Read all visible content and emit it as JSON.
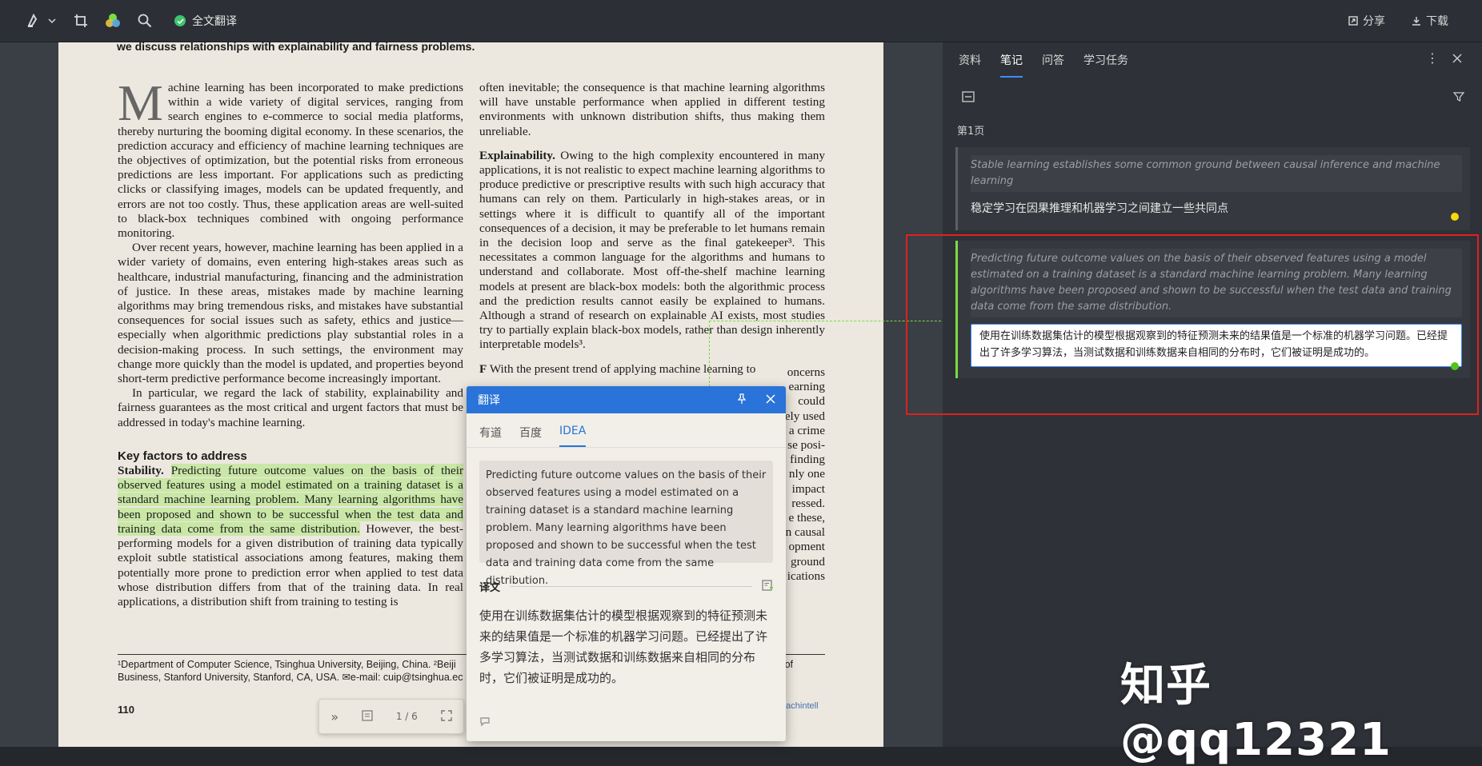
{
  "toolbar": {
    "translate_all_label": "全文翻译",
    "share_label": "分享",
    "download_label": "下载"
  },
  "document": {
    "top_heading": "we discuss relationships with explainability and fairness problems.",
    "col1": {
      "dropcap": "M",
      "p1": "achine learning has been incorporated to make predictions within a wide variety of digital services, ranging from search engines to e-commerce to social media platforms, thereby nurturing the booming digital economy. In these scenarios, the prediction accuracy and efficiency of machine learning techniques are the objectives of optimization, but the potential risks from erroneous predictions are less important. For applications such as predicting clicks or classifying images, models can be updated frequently, and errors are not too costly. Thus, these application areas are well-suited to black-box techniques combined with ongoing performance monitoring.",
      "p2": "Over recent years, however, machine learning has been applied in a wider variety of domains, even entering high-stakes areas such as healthcare, industrial manufacturing, financing and the administration of justice. In these areas, mistakes made by machine learning algorithms may bring tremendous risks, and mistakes have substantial consequences for social issues such as safety, ethics and justice—especially when algorithmic predictions play substantial roles in a decision-making process. In such settings, the environment may change more quickly than the model is updated, and properties beyond short-term predictive performance become increasingly important.",
      "p3": "In particular, we regard the lack of stability, explainability and fairness guarantees as the most critical and urgent factors that must be addressed in today's machine learning.",
      "section_heading": "Key factors to address",
      "stability_label": "Stability.",
      "stability_highlight": "Predicting future outcome values on the basis of their observed features using a model estimated on a training dataset is a standard machine learning problem. Many learning algorithms have been proposed and shown to be successful when the test data and training data come from the same distribution.",
      "stability_rest": "However, the best-performing models for a given distribution of training data typically exploit subtle statistical associations among features, making them potentially more prone to prediction error when applied to test data whose distribution differs from that of the training data. In real applications, a distribution shift from training to testing is"
    },
    "col2": {
      "p1": "often inevitable; the consequence is that machine learning algorithms will have unstable performance when applied in different testing environments with unknown distribution shifts, thus making them unreliable.",
      "explain_label": "Explainability.",
      "p2": "Owing to the high complexity encountered in many applications, it is not realistic to expect machine learning algorithms to produce predictive or prescriptive results with such high accuracy that humans can rely on them. Particularly in high-stakes areas, or in settings where it is difficult to quantify all of the important consequences of a decision, it may be preferable to let humans remain in the decision loop and serve as the final gatekeeper³. This necessitates a common language for the algorithms and humans to understand and collaborate. Most off-the-shelf machine learning models at present are black-box models: both the algorithmic process and the prediction results cannot easily be explained to humans. Although a strand of research on explainable AI exists, most studies try to partially explain black-box models, rather than design inherently interpretable models³.",
      "p3_start": "F",
      "p3_head": "With the present trend of applying machine learning to",
      "right_fragments": [
        "oncerns",
        "earning",
        "could",
        "ely used",
        "a crime",
        "se posi-",
        "finding",
        "nly one",
        "impact",
        "ressed.",
        "e these,",
        "n causal",
        "opment",
        "ground",
        "ications"
      ]
    },
    "footnote": "¹Department of Computer Science, Tsinghua University, Beijing, China. ²Beiji",
    "footnote2": "Business, Stanford University, Stanford, CA, USA. ✉e-mail: cuip@tsinghua.ec",
    "footnote_right": "of",
    "page_number": "110",
    "journal_link": "machintell"
  },
  "pager": {
    "page_display": "1 / 6"
  },
  "translate_popup": {
    "title": "翻译",
    "tabs": [
      "有道",
      "百度",
      "IDEA"
    ],
    "active_tab": "IDEA",
    "source_text": "Predicting future outcome values on the basis of their observed features using a model estimated on a training dataset is a standard machine learning problem. Many learning algorithms have been proposed and shown to be successful when the test data and training data come from the same distribution.",
    "result_label": "译文",
    "result_text": "使用在训练数据集估计的模型根据观察到的特征预测未来的结果值是一个标准的机器学习问题。已经提出了许多学习算法，当测试数据和训练数据来自相同的分布时，它们被证明是成功的。"
  },
  "right_panel": {
    "tabs": [
      "资料",
      "笔记",
      "问答",
      "学习任务"
    ],
    "active_tab": "笔记",
    "page_label": "第1页",
    "notes": [
      {
        "source": "Stable learning establishes some common ground between causal inference and machine learning",
        "translation": "稳定学习在因果推理和机器学习之间建立一些共同点",
        "dot_color": "#f5d90a"
      },
      {
        "source": "Predicting future outcome values on the basis of their observed features using a model estimated on a training dataset is a standard machine learning problem. Many learning algorithms have been proposed and shown to be successful when the test data and training data come from the same distribution.",
        "translation": "使用在训练数据集估计的模型根据观察到的特征预测未来的结果值是一个标准的机器学习问题。已经提出了许多学习算法，当测试数据和训练数据来自相同的分布时，它们被证明是成功的。",
        "dot_color": "#52c41a"
      }
    ]
  },
  "watermark": "知乎 @qq12321",
  "colors": {
    "accent": "#2a73d8",
    "highlight": "#c9e7a6",
    "note_bar": "#7bdc42",
    "annotation_box": "#e02020"
  }
}
